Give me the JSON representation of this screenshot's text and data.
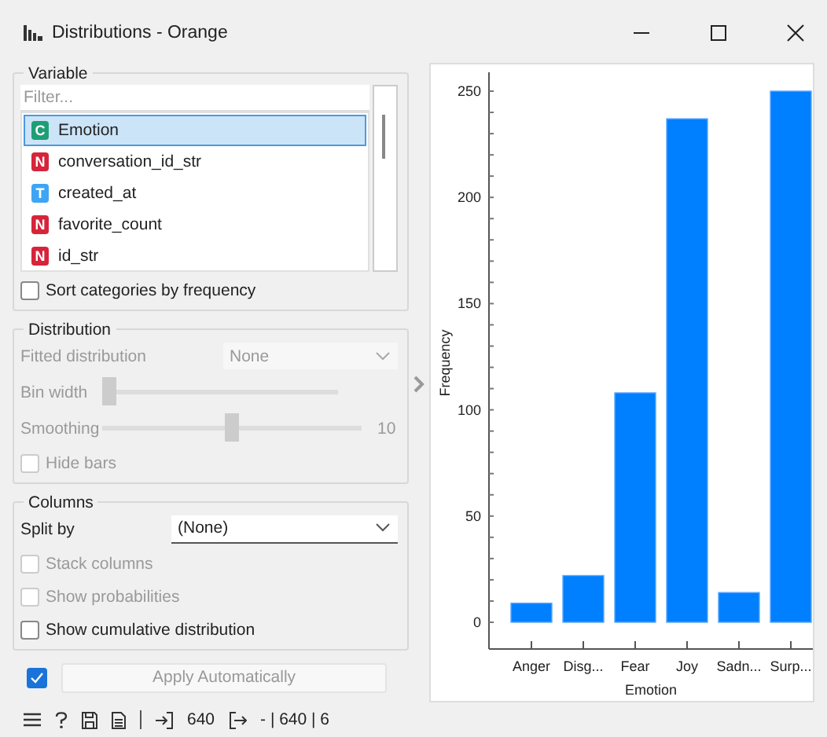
{
  "window": {
    "title": "Distributions - Orange"
  },
  "variable": {
    "title": "Variable",
    "filter_placeholder": "Filter...",
    "items": [
      {
        "badge": "C",
        "color": "#1f9e76",
        "name": "Emotion",
        "selected": true
      },
      {
        "badge": "N",
        "color": "#d6243a",
        "name": "conversation_id_str",
        "selected": false
      },
      {
        "badge": "T",
        "color": "#3da5f4",
        "name": "created_at",
        "selected": false
      },
      {
        "badge": "N",
        "color": "#d6243a",
        "name": "favorite_count",
        "selected": false
      },
      {
        "badge": "N",
        "color": "#d6243a",
        "name": "id_str",
        "selected": false
      }
    ],
    "sort": {
      "label": "Sort categories by frequency",
      "checked": false
    }
  },
  "distribution": {
    "title": "Distribution",
    "disabled": true,
    "fitted_label": "Fitted distribution",
    "fitted_value": "None",
    "bin_width": {
      "label": "Bin width",
      "level": 0
    },
    "smoothing": {
      "label": "Smoothing",
      "level": 0.5,
      "value": "10"
    },
    "hide_bars": {
      "label": "Hide bars",
      "checked": false
    }
  },
  "columns": {
    "title": "Columns",
    "split_label": "Split by",
    "split_value": "(None)",
    "checkboxes": [
      {
        "label": "Stack columns",
        "checked": false,
        "disabled": true
      },
      {
        "label": "Show probabilities",
        "checked": false,
        "disabled": true
      },
      {
        "label": "Show cumulative distribution",
        "checked": false,
        "disabled": false
      }
    ]
  },
  "apply": {
    "label": "Apply Automatically",
    "checked": true
  },
  "status": {
    "input_count": "640",
    "output_summary": "- | 640 | 6"
  },
  "chart": {
    "chart_data": {
      "type": "bar",
      "xlabel": "Emotion",
      "ylabel": "Frequency",
      "categories": [
        "Anger",
        "Disg...",
        "Fear",
        "Joy",
        "Sadn...",
        "Surp..."
      ],
      "values": [
        9,
        22,
        108,
        237,
        14,
        250
      ],
      "ylim": [
        0,
        250
      ],
      "yticks": [
        0,
        50,
        100,
        150,
        200,
        250
      ]
    }
  }
}
